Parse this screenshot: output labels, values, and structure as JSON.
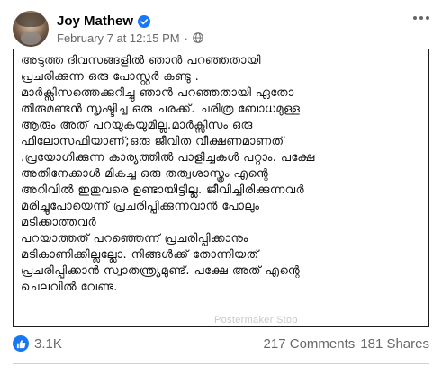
{
  "author": {
    "name": "Joy Mathew",
    "timestamp": "February 7 at 12:15 PM",
    "separator": "·"
  },
  "post": {
    "lines": [
      "അടുത്ത ദിവസങ്ങളിൽ ഞാൻ പറഞ്ഞതായി",
      "പ്രചരിക്കുന്ന ഒരു പോസ്റ്റർ കണ്ടു .",
      "മാർക്സിസത്തെക്കുറിച്ചു ഞാൻ പറഞ്ഞതായി ഏതോ",
      "തിരുമണ്ടൻ സൃഷ്ടിച്ച ഒരു ചരക്ക്. ചരിത്ര ബോധമുള്ള",
      "ആരും അത് പറയുകയുമില്ല.മാർക്സിസം ഒരു",
      "ഫിലോസഫിയാണ്;ഒരു ജീവിത വീക്ഷണമാണത്",
      ".പ്രയോഗിക്കുന്ന കാര്യത്തിൽ പാളിച്ചകൾ പറ്റാം. പക്ഷേ",
      "അതിനേക്കാൾ മികച്ച ഒരു തത്വശാസ്ത്രം എന്റെ",
      "അറിവിൽ ഇതുവരെ ഉണ്ടായിട്ടില്ല. ജീവിച്ചിരിക്കുന്നവർ",
      "മരിച്ചുപോയെന്ന് പ്രചരിപ്പിക്കുന്നവാൻ പോലും",
      "മടിക്കാത്തവർ",
      "പറയാത്തത് പറഞ്ഞെന്ന് പ്രചരിപ്പിക്കാനും",
      "മടികാണിക്കില്ലല്ലോ. നിങ്ങൾക്ക് തോന്നിയത്",
      "പ്രചരിപ്പിക്കാൻ സ്വാതന്ത്ര്യമുണ്ട്. പക്ഷേ അത് എന്റെ",
      "ചെലവിൽ വേണ്ട."
    ],
    "watermark": "Postermaker Stop"
  },
  "stats": {
    "reactions": "3.1K",
    "comments": "217 Comments",
    "shares": "181 Shares"
  },
  "colors": {
    "brand": "#1877f2",
    "secondary_text": "#65676b",
    "primary_text": "#050505",
    "border": "#1c1c1c",
    "divider": "#ced0d4"
  },
  "icons": {
    "verified": "verified-badge-icon",
    "audience": "globe-icon",
    "menu": "more-options-icon",
    "reaction": "like-icon"
  }
}
